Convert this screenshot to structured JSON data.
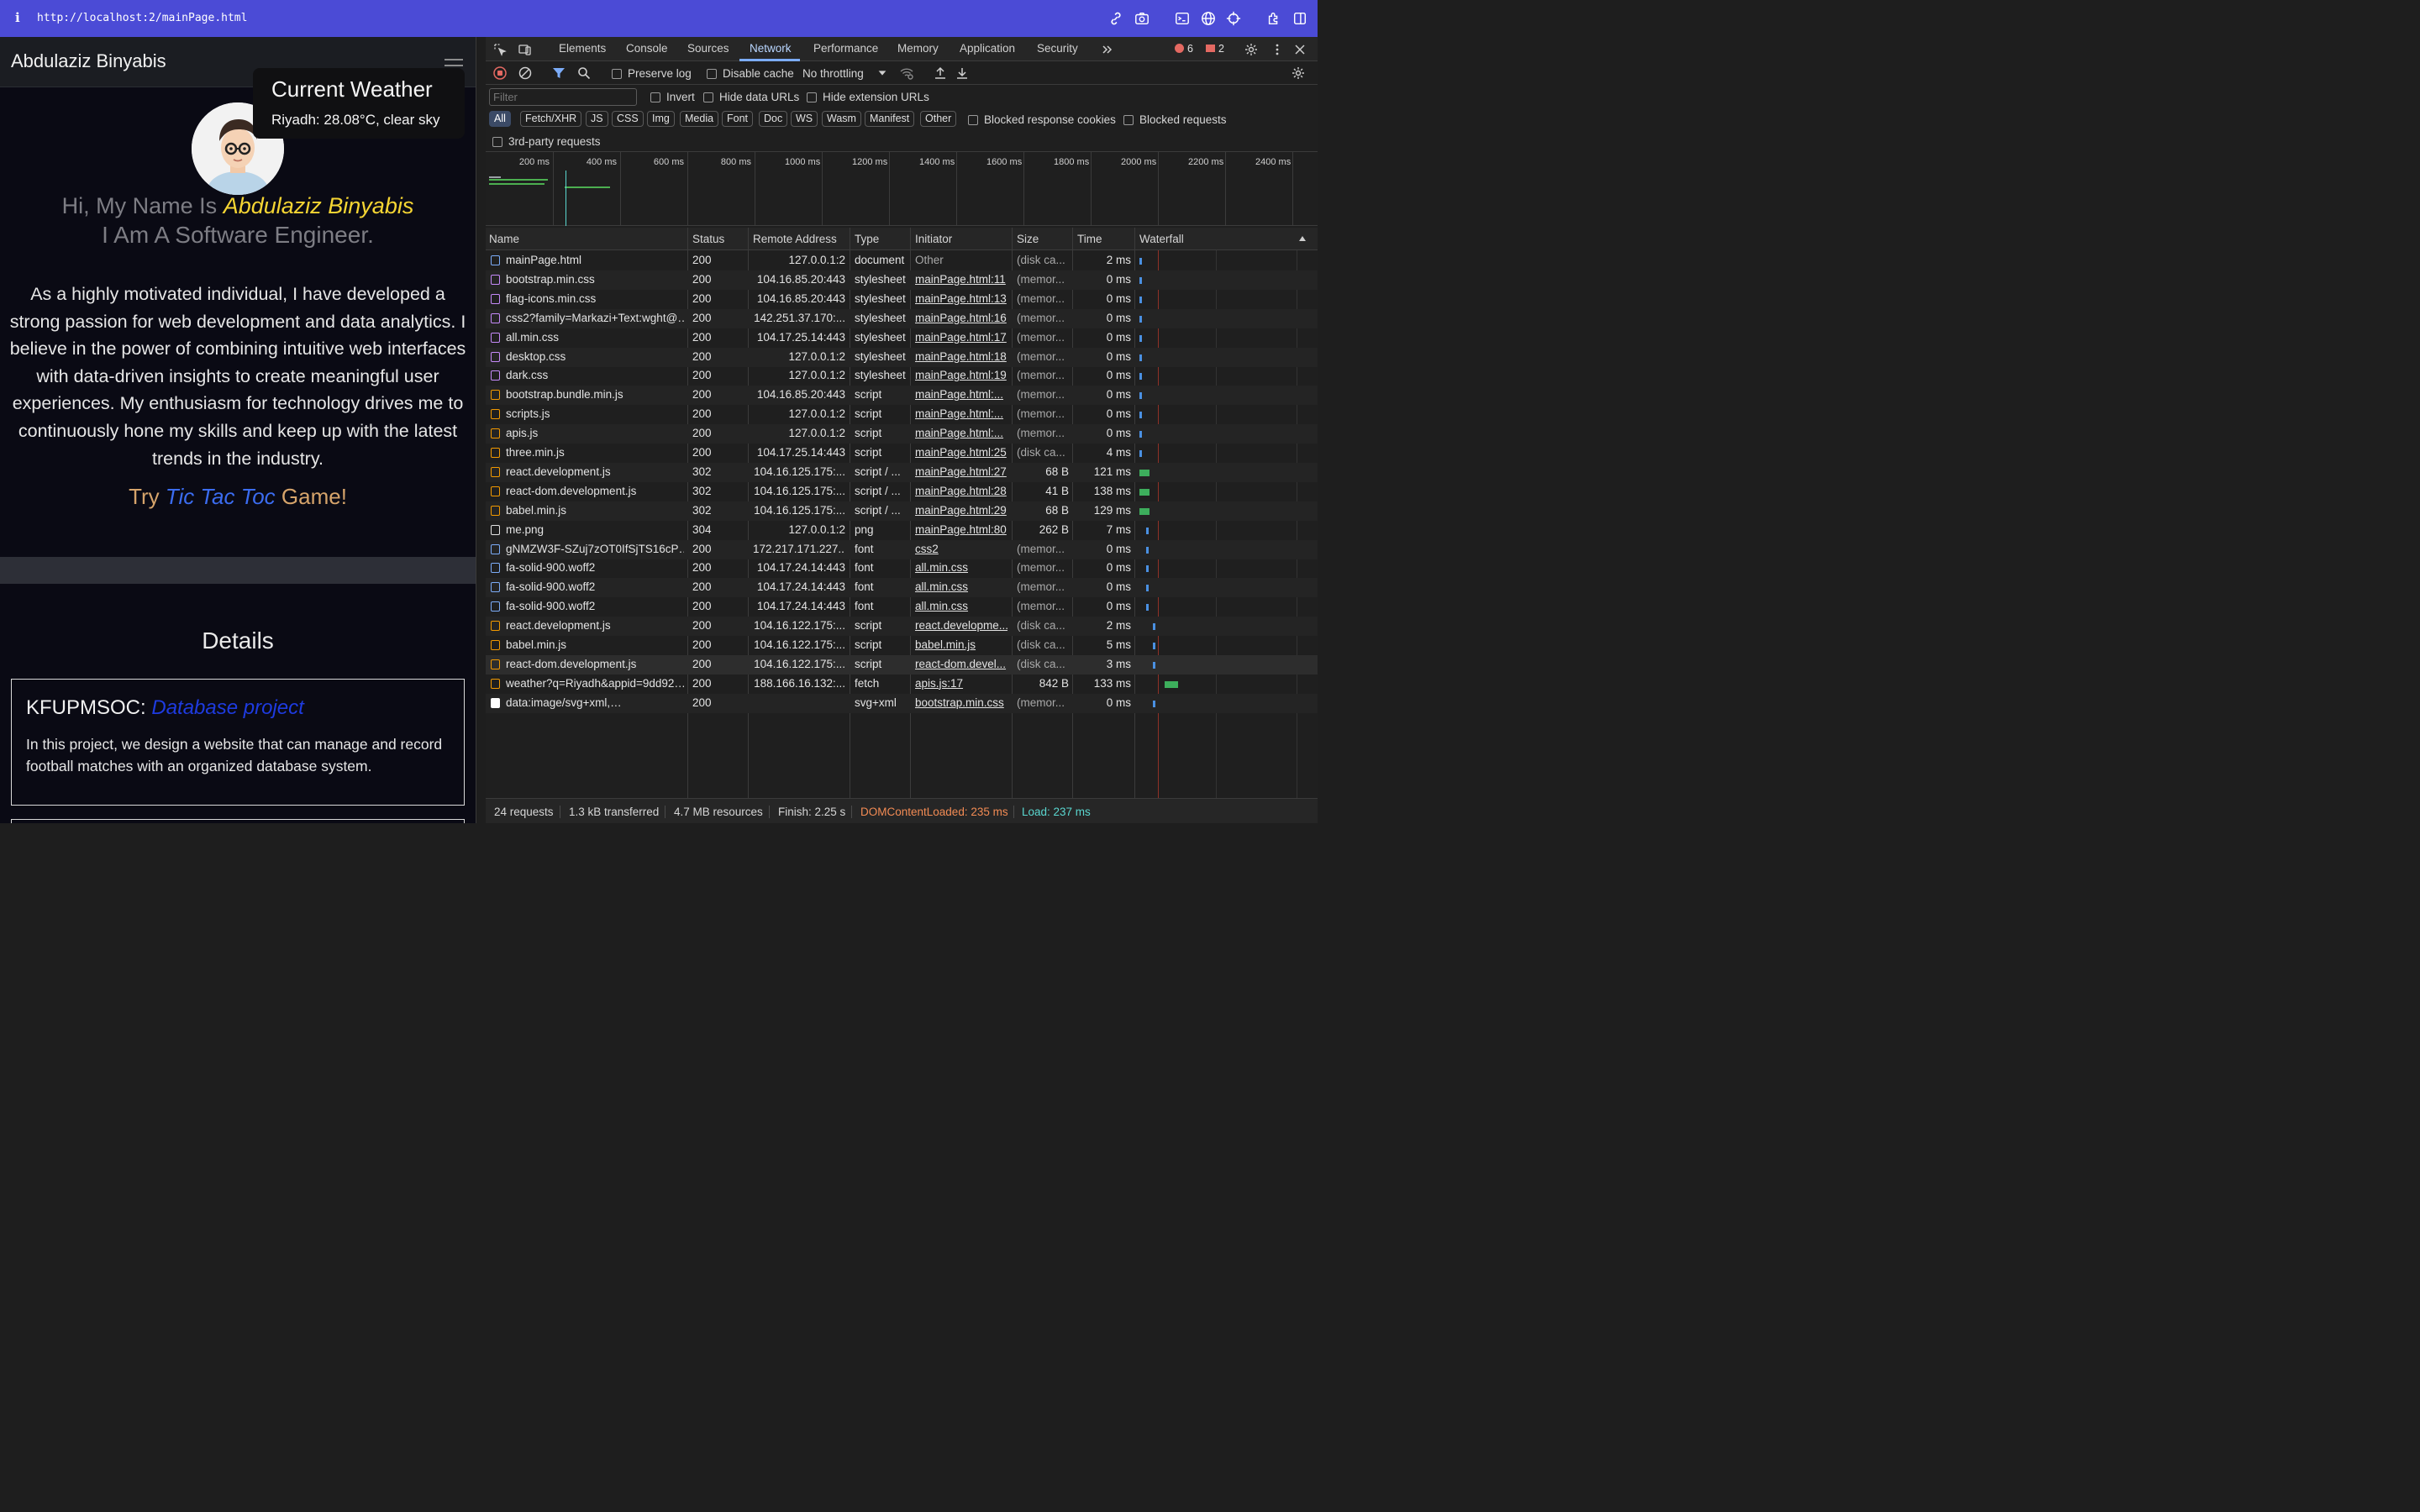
{
  "browser": {
    "info_glyph": "i",
    "url": "http://localhost:2/mainPage.html"
  },
  "page": {
    "brand": "Abdulaziz Binyabis",
    "weather_title": "Current Weather",
    "weather_text": "Riyadh: 28.08°C, clear sky",
    "hero_prefix": "Hi, My Name Is",
    "hero_name": "Abdulaziz Binyabis",
    "hero_role": "I Am A Software Engineer.",
    "about": "As a highly motivated individual, I have developed a strong passion for web development and data analytics. I believe in the power of combining intuitive web interfaces with data-driven insights to create meaningful user experiences. My enthusiasm for technology drives me to continuously hone my skills and keep up with the latest trends in the industry.",
    "try_prefix": "Try",
    "try_game": "Tic Tac Toc",
    "try_suffix": "Game!",
    "details_title": "Details",
    "card": {
      "org": "KFUPMSOC:",
      "project": "Database project",
      "desc": "In this project, we design a website that can manage and record football matches with an organized database system."
    }
  },
  "devtools": {
    "tabs": [
      "Elements",
      "Console",
      "Sources",
      "Network",
      "Performance",
      "Memory",
      "Application",
      "Security"
    ],
    "active_tab": "Network",
    "error_count": "6",
    "issue_count": "2",
    "preserve_log": "Preserve log",
    "disable_cache": "Disable cache",
    "throttling": "No throttling",
    "filter_placeholder": "Filter",
    "invert": "Invert",
    "hide_data_urls": "Hide data URLs",
    "hide_ext_urls": "Hide extension URLs",
    "type_filters": [
      "All",
      "Fetch/XHR",
      "JS",
      "CSS",
      "Img",
      "Media",
      "Font",
      "Doc",
      "WS",
      "Wasm",
      "Manifest",
      "Other"
    ],
    "blocked_cookies": "Blocked response cookies",
    "blocked_requests": "Blocked requests",
    "third_party": "3rd-party requests",
    "overview_ticks": [
      "200 ms",
      "400 ms",
      "600 ms",
      "800 ms",
      "1000 ms",
      "1200 ms",
      "1400 ms",
      "1600 ms",
      "1800 ms",
      "2000 ms",
      "2200 ms",
      "2400 ms"
    ],
    "columns": [
      "Name",
      "Status",
      "Remote Address",
      "Type",
      "Initiator",
      "Size",
      "Time",
      "Waterfall"
    ],
    "rows": [
      {
        "name": "mainPage.html",
        "status": "200",
        "remote": "127.0.0.1:2",
        "type": "document",
        "initiator": "Other",
        "init_link": false,
        "size": "(disk ca...",
        "time": "2 ms",
        "kind": "doc",
        "wf": 0.3
      },
      {
        "name": "bootstrap.min.css",
        "status": "200",
        "remote": "104.16.85.20:443",
        "type": "stylesheet",
        "initiator": "mainPage.html:11",
        "init_link": true,
        "size": "(memor...",
        "time": "0 ms",
        "kind": "css",
        "wf": 0.3
      },
      {
        "name": "flag-icons.min.css",
        "status": "200",
        "remote": "104.16.85.20:443",
        "type": "stylesheet",
        "initiator": "mainPage.html:13",
        "init_link": true,
        "size": "(memor...",
        "time": "0 ms",
        "kind": "css",
        "wf": 0.3
      },
      {
        "name": "css2?family=Markazi+Text:wght@…",
        "status": "200",
        "remote": "142.251.37.170:...",
        "type": "stylesheet",
        "initiator": "mainPage.html:16",
        "init_link": true,
        "size": "(memor...",
        "time": "0 ms",
        "kind": "css",
        "wf": 0.3
      },
      {
        "name": "all.min.css",
        "status": "200",
        "remote": "104.17.25.14:443",
        "type": "stylesheet",
        "initiator": "mainPage.html:17",
        "init_link": true,
        "size": "(memor...",
        "time": "0 ms",
        "kind": "css",
        "wf": 0.3
      },
      {
        "name": "desktop.css",
        "status": "200",
        "remote": "127.0.0.1:2",
        "type": "stylesheet",
        "initiator": "mainPage.html:18",
        "init_link": true,
        "size": "(memor...",
        "time": "0 ms",
        "kind": "css",
        "wf": 0.3
      },
      {
        "name": "dark.css",
        "status": "200",
        "remote": "127.0.0.1:2",
        "type": "stylesheet",
        "initiator": "mainPage.html:19",
        "init_link": true,
        "size": "(memor...",
        "time": "0 ms",
        "kind": "css",
        "wf": 0.3
      },
      {
        "name": "bootstrap.bundle.min.js",
        "status": "200",
        "remote": "104.16.85.20:443",
        "type": "script",
        "initiator": "mainPage.html:...",
        "init_link": true,
        "size": "(memor...",
        "time": "0 ms",
        "kind": "js",
        "wf": 0.3
      },
      {
        "name": "scripts.js",
        "status": "200",
        "remote": "127.0.0.1:2",
        "type": "script",
        "initiator": "mainPage.html:...",
        "init_link": true,
        "size": "(memor...",
        "time": "0 ms",
        "kind": "js",
        "wf": 0.3
      },
      {
        "name": "apis.js",
        "status": "200",
        "remote": "127.0.0.1:2",
        "type": "script",
        "initiator": "mainPage.html:...",
        "init_link": true,
        "size": "(memor...",
        "time": "0 ms",
        "kind": "js",
        "wf": 0.3
      },
      {
        "name": "three.min.js",
        "status": "200",
        "remote": "104.17.25.14:443",
        "type": "script",
        "initiator": "mainPage.html:25",
        "init_link": true,
        "size": "(disk ca...",
        "time": "4 ms",
        "kind": "js",
        "wf": 0.4
      },
      {
        "name": "react.development.js",
        "status": "302",
        "remote": "104.16.125.175:...",
        "type": "script / ...",
        "initiator": "mainPage.html:27",
        "init_link": true,
        "size": "68 B",
        "time": "121 ms",
        "kind": "js",
        "wf": 0.5
      },
      {
        "name": "react-dom.development.js",
        "status": "302",
        "remote": "104.16.125.175:...",
        "type": "script / ...",
        "initiator": "mainPage.html:28",
        "init_link": true,
        "size": "41 B",
        "time": "138 ms",
        "kind": "js",
        "wf": 0.5
      },
      {
        "name": "babel.min.js",
        "status": "302",
        "remote": "104.16.125.175:...",
        "type": "script / ...",
        "initiator": "mainPage.html:29",
        "init_link": true,
        "size": "68 B",
        "time": "129 ms",
        "kind": "js",
        "wf": 0.5
      },
      {
        "name": "me.png",
        "status": "304",
        "remote": "127.0.0.1:2",
        "type": "png",
        "initiator": "mainPage.html:80",
        "init_link": true,
        "size": "262 B",
        "time": "7 ms",
        "kind": "img",
        "wf": 0.4
      },
      {
        "name": "gNMZW3F-SZuj7zOT0IfSjTS16cP…",
        "status": "200",
        "remote": "172.217.171.227...",
        "type": "font",
        "initiator": "css2",
        "init_link": true,
        "size": "(memor...",
        "time": "0 ms",
        "kind": "font",
        "wf": 0.3
      },
      {
        "name": "fa-solid-900.woff2",
        "status": "200",
        "remote": "104.17.24.14:443",
        "type": "font",
        "initiator": "all.min.css",
        "init_link": true,
        "size": "(memor...",
        "time": "0 ms",
        "kind": "font",
        "wf": 0.3
      },
      {
        "name": "fa-solid-900.woff2",
        "status": "200",
        "remote": "104.17.24.14:443",
        "type": "font",
        "initiator": "all.min.css",
        "init_link": true,
        "size": "(memor...",
        "time": "0 ms",
        "kind": "font",
        "wf": 0.3
      },
      {
        "name": "fa-solid-900.woff2",
        "status": "200",
        "remote": "104.17.24.14:443",
        "type": "font",
        "initiator": "all.min.css",
        "init_link": true,
        "size": "(memor...",
        "time": "0 ms",
        "kind": "font",
        "wf": 0.3
      },
      {
        "name": "react.development.js",
        "status": "200",
        "remote": "104.16.122.175:...",
        "type": "script",
        "initiator": "react.developme...",
        "init_link": true,
        "size": "(disk ca...",
        "time": "2 ms",
        "kind": "js",
        "wf": 0.4
      },
      {
        "name": "babel.min.js",
        "status": "200",
        "remote": "104.16.122.175:...",
        "type": "script",
        "initiator": "babel.min.js",
        "init_link": true,
        "size": "(disk ca...",
        "time": "5 ms",
        "kind": "js",
        "wf": 0.4
      },
      {
        "name": "react-dom.development.js",
        "status": "200",
        "remote": "104.16.122.175:...",
        "type": "script",
        "initiator": "react-dom.devel...",
        "init_link": true,
        "size": "(disk ca...",
        "time": "3 ms",
        "kind": "js",
        "wf": 0.4
      },
      {
        "name": "weather?q=Riyadh&appid=9dd92…",
        "status": "200",
        "remote": "188.166.16.132:...",
        "type": "fetch",
        "initiator": "apis.js:17",
        "init_link": true,
        "size": "842 B",
        "time": "133 ms",
        "kind": "fetch",
        "wf": 0.5
      },
      {
        "name": "data:image/svg+xml,…",
        "status": "200",
        "remote": "",
        "type": "svg+xml",
        "initiator": "bootstrap.min.css",
        "init_link": true,
        "size": "(memor...",
        "time": "0 ms",
        "kind": "data",
        "wf": 0.3
      }
    ],
    "summary": {
      "requests": "24 requests",
      "transferred": "1.3 kB transferred",
      "resources": "4.7 MB resources",
      "finish": "Finish: 2.25 s",
      "dcl": "DOMContentLoaded: 235 ms",
      "load": "Load: 237 ms"
    },
    "colors": {
      "dcl": "#f28b54",
      "load": "#5ad7d0",
      "accent": "#7cacf8",
      "error": "#e46962"
    }
  }
}
